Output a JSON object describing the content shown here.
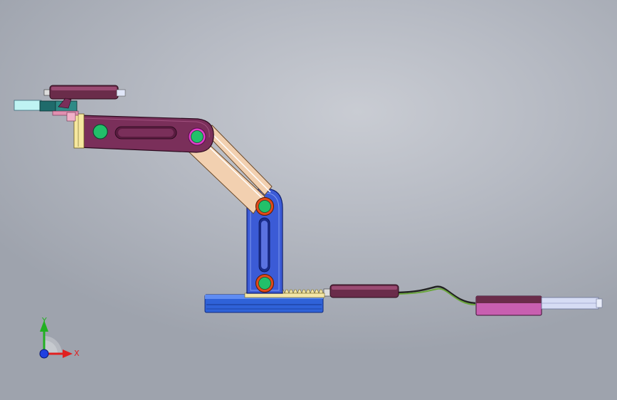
{
  "triad": {
    "x_label": "X",
    "y_label": "Y"
  },
  "colors": {
    "background": "#b6bac3",
    "upper_arm": "#7a2f5a",
    "lower_arm": "#3b5bd6",
    "base": "#2f62d8",
    "link_bar": "#f2d0b0",
    "pin_green": "#22c06a",
    "pin_ring_orange": "#e04a1a",
    "pin_ring_magenta": "#e040c8",
    "cylinder_body": "#6a2c4a",
    "rack": "#f3e6a8",
    "gripper": "#bff3f3",
    "cable_green": "#6aa63c",
    "axis_x": "#e02020",
    "axis_y": "#22b022",
    "axis_z": "#2040e0"
  },
  "icons": {
    "triad": "coordinate-triad-icon",
    "pin": "pivot-pin-icon"
  }
}
